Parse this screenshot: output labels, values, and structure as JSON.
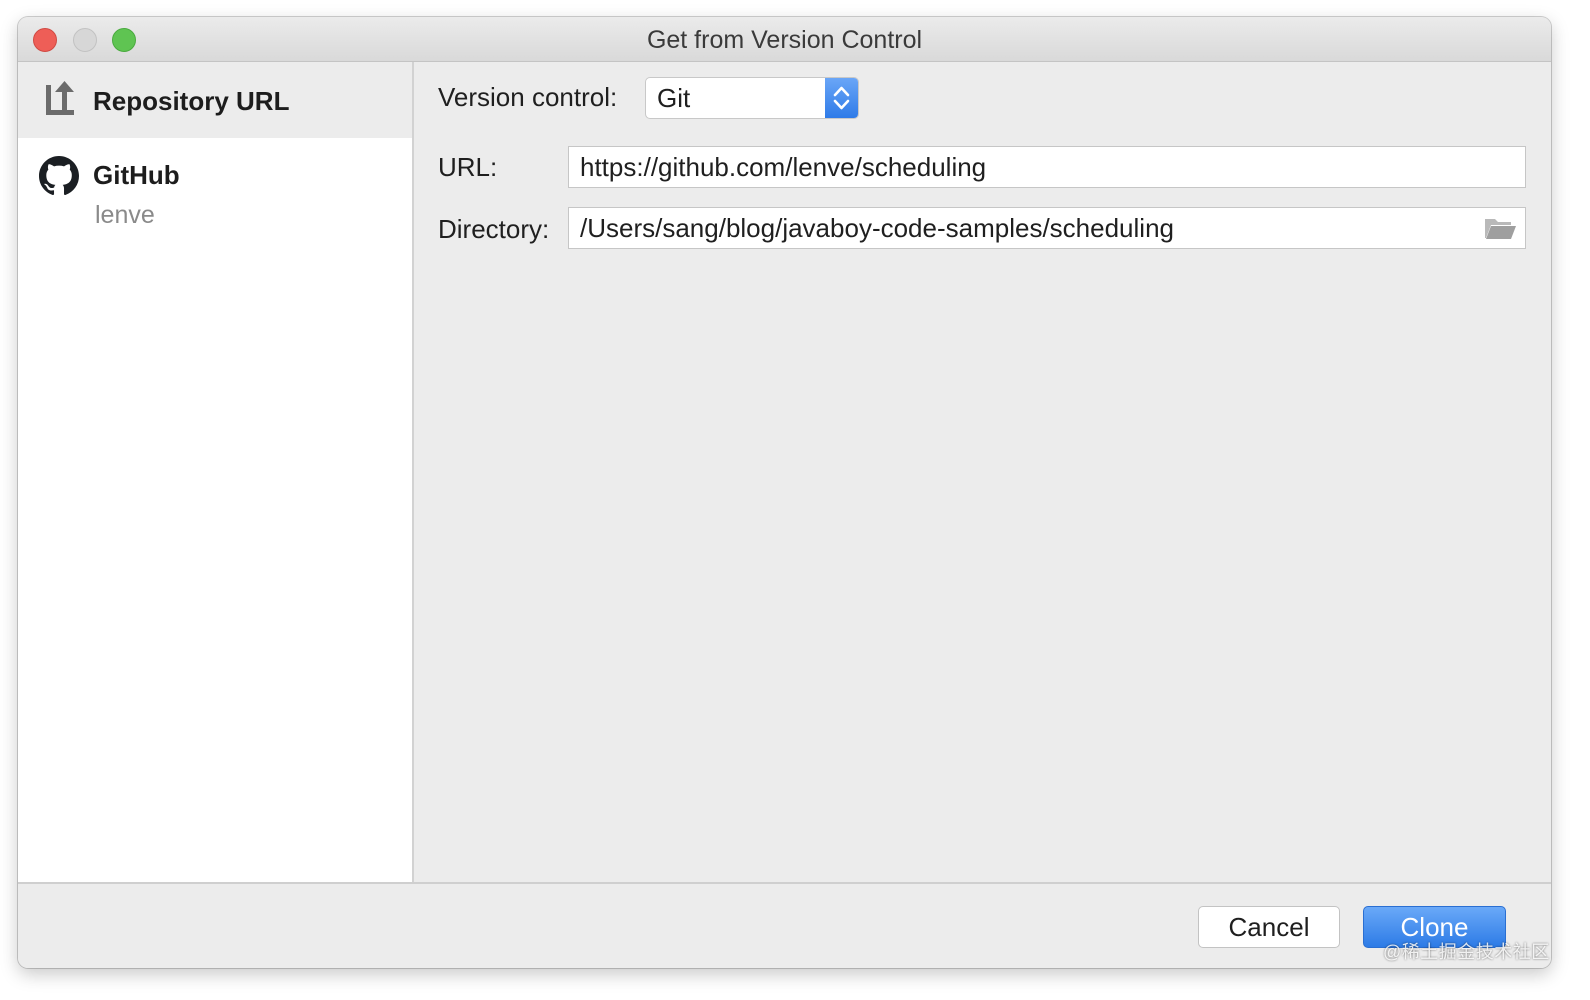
{
  "window": {
    "title": "Get from Version Control"
  },
  "sidebar": {
    "items": [
      {
        "label": "Repository URL",
        "icon": "repository-url-icon",
        "selected": true
      },
      {
        "label": "GitHub",
        "sublabel": "lenve",
        "icon": "github-icon",
        "selected": false
      }
    ]
  },
  "form": {
    "version_control_label": "Version control:",
    "version_control_value": "Git",
    "url_label": "URL:",
    "url_value": "https://github.com/lenve/scheduling",
    "directory_label": "Directory:",
    "directory_value": "/Users/sang/blog/javaboy-code-samples/scheduling",
    "browse_icon": "folder-open-icon"
  },
  "footer": {
    "cancel_label": "Cancel",
    "clone_label": "Clone"
  },
  "watermark": "@稀土掘金技术社区",
  "colors": {
    "accent": "#2f7be8",
    "close": "#ee5e57",
    "minimize": "#d7d7d7",
    "zoom": "#5fc452"
  }
}
